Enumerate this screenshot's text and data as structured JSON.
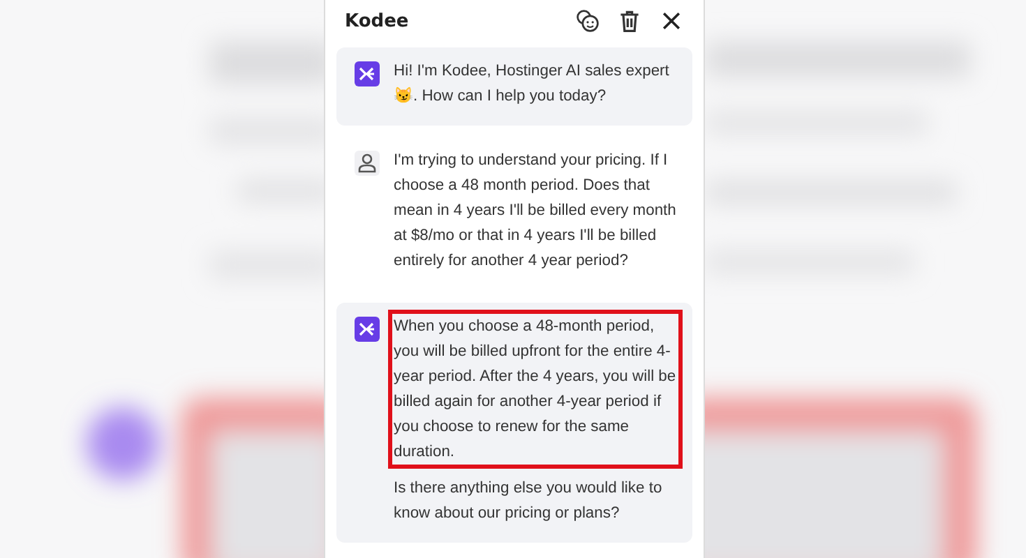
{
  "chat_panel": {
    "title": "Kodee",
    "messages": [
      {
        "kind": "bot",
        "paragraphs": [
          {
            "text": "Hi! I'm Kodee, Hostinger AI sales expert 😼. How can I help you today?",
            "highlighted": false
          }
        ]
      },
      {
        "kind": "user",
        "paragraphs": [
          {
            "text": "I'm trying to understand your pricing. If I choose a 48 month period. Does that mean in 4 years I'll be billed every month at $8/mo or that in 4 years I'll be billed entirely for another 4 year period?",
            "highlighted": false
          }
        ]
      },
      {
        "kind": "bot",
        "paragraphs": [
          {
            "text": "When you choose a 48-month period, you will be billed upfront for the entire 4-year period. After the 4 years, you will be billed again for another 4-year period if you choose to renew for the same duration.",
            "highlighted": true
          },
          {
            "text": "Is there anything else you would like to know about our pricing or plans?",
            "highlighted": false
          }
        ]
      }
    ]
  }
}
